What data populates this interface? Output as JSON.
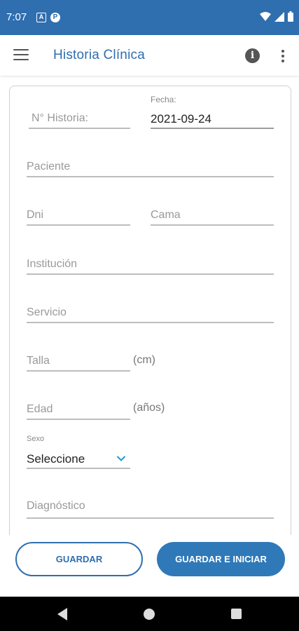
{
  "status": {
    "time": "7:07",
    "icon_a": "A",
    "icon_p": "P"
  },
  "appbar": {
    "title": "Historia Clínica"
  },
  "form": {
    "historia_placeholder": "N° Historia:",
    "fecha_label": "Fecha:",
    "fecha_value": "2021-09-24",
    "paciente_placeholder": "Paciente",
    "dni_placeholder": "Dni",
    "cama_placeholder": "Cama",
    "institucion_placeholder": "Institución",
    "servicio_placeholder": "Servicio",
    "talla_placeholder": "Talla",
    "talla_unit": "(cm)",
    "edad_placeholder": "Edad",
    "edad_unit": "(años)",
    "sexo_label": "Sexo",
    "sexo_value": "Seleccione",
    "diagnostico_placeholder": "Diagnóstico"
  },
  "buttons": {
    "guardar": "GUARDAR",
    "guardar_iniciar": "GUARDAR E INICIAR"
  },
  "colors": {
    "primary": "#2f6eaf",
    "accent": "#1a9bd7"
  }
}
